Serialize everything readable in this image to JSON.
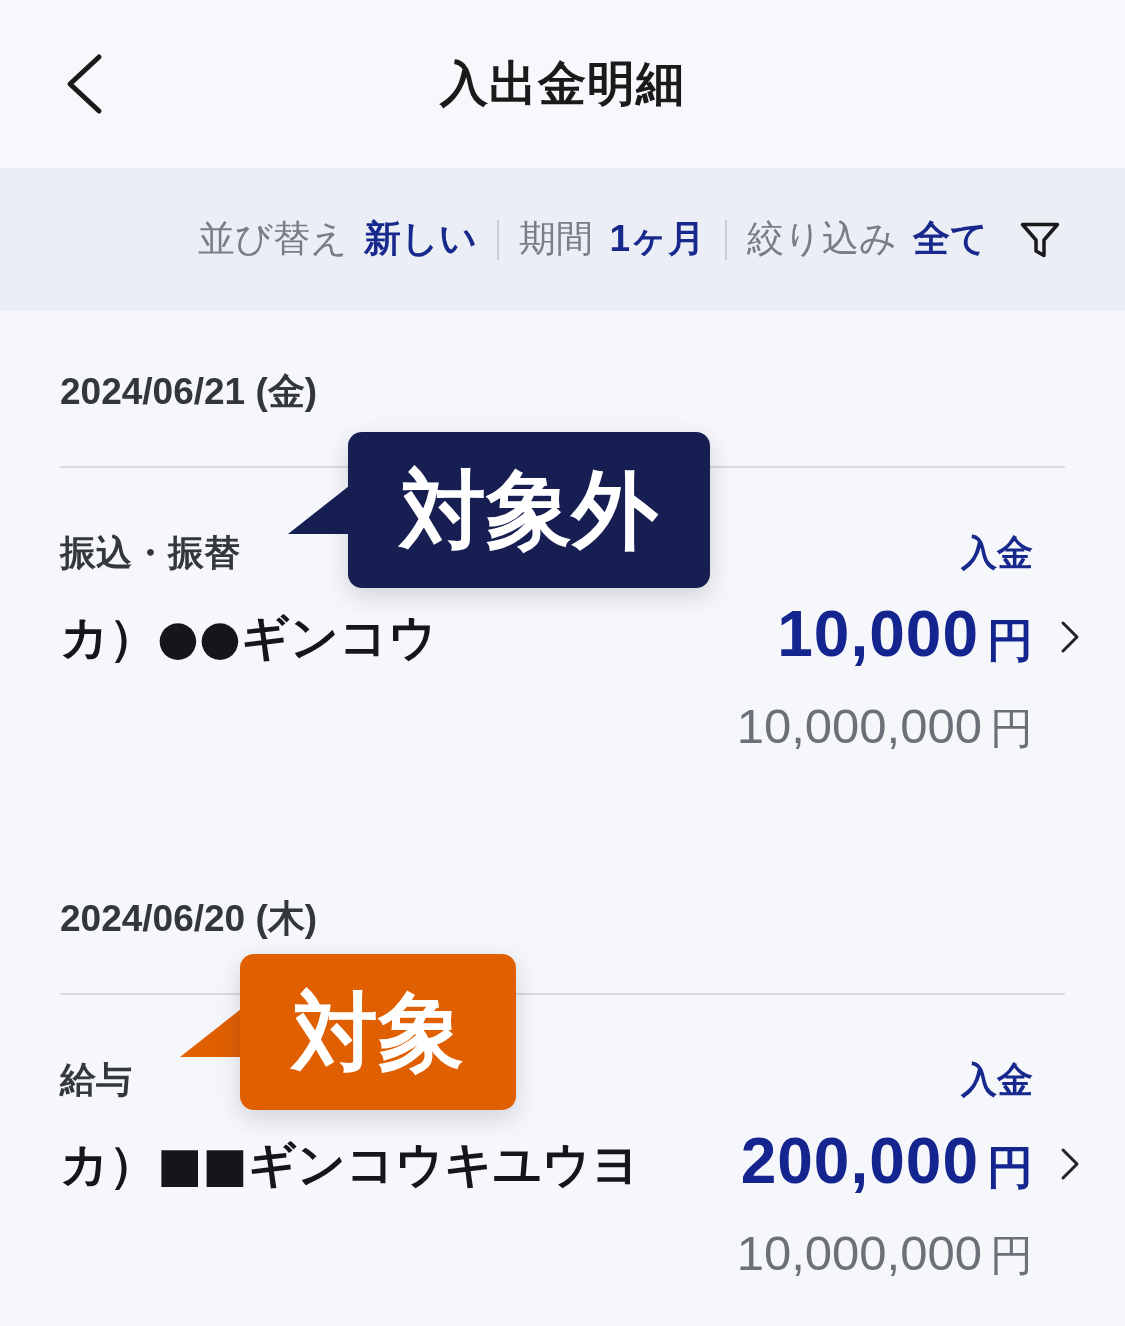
{
  "header": {
    "title": "入出金明細"
  },
  "filter_bar": {
    "items": [
      {
        "label": "並び替え",
        "value": "新しい"
      },
      {
        "label": "期間",
        "value": "1ヶ月"
      },
      {
        "label": "絞り込み",
        "value": "全て"
      }
    ]
  },
  "sections": [
    {
      "date": "2024/06/21 (金)",
      "transactions": [
        {
          "category": "振込・振替",
          "type": "入金",
          "name": "カ）●●ギンコウ",
          "amount": "10,000",
          "amount_unit": "円",
          "balance": "10,000,000",
          "balance_unit": "円",
          "callout": {
            "text": "対象外",
            "color": "#161e52"
          }
        }
      ]
    },
    {
      "date": "2024/06/20 (木)",
      "transactions": [
        {
          "category": "給与",
          "type": "入金",
          "name": "カ）■■ギンコウキユウヨ",
          "amount": "200,000",
          "amount_unit": "円",
          "balance": "10,000,000",
          "balance_unit": "円",
          "callout": {
            "text": "対象",
            "color": "#e05f00"
          }
        }
      ]
    }
  ]
}
